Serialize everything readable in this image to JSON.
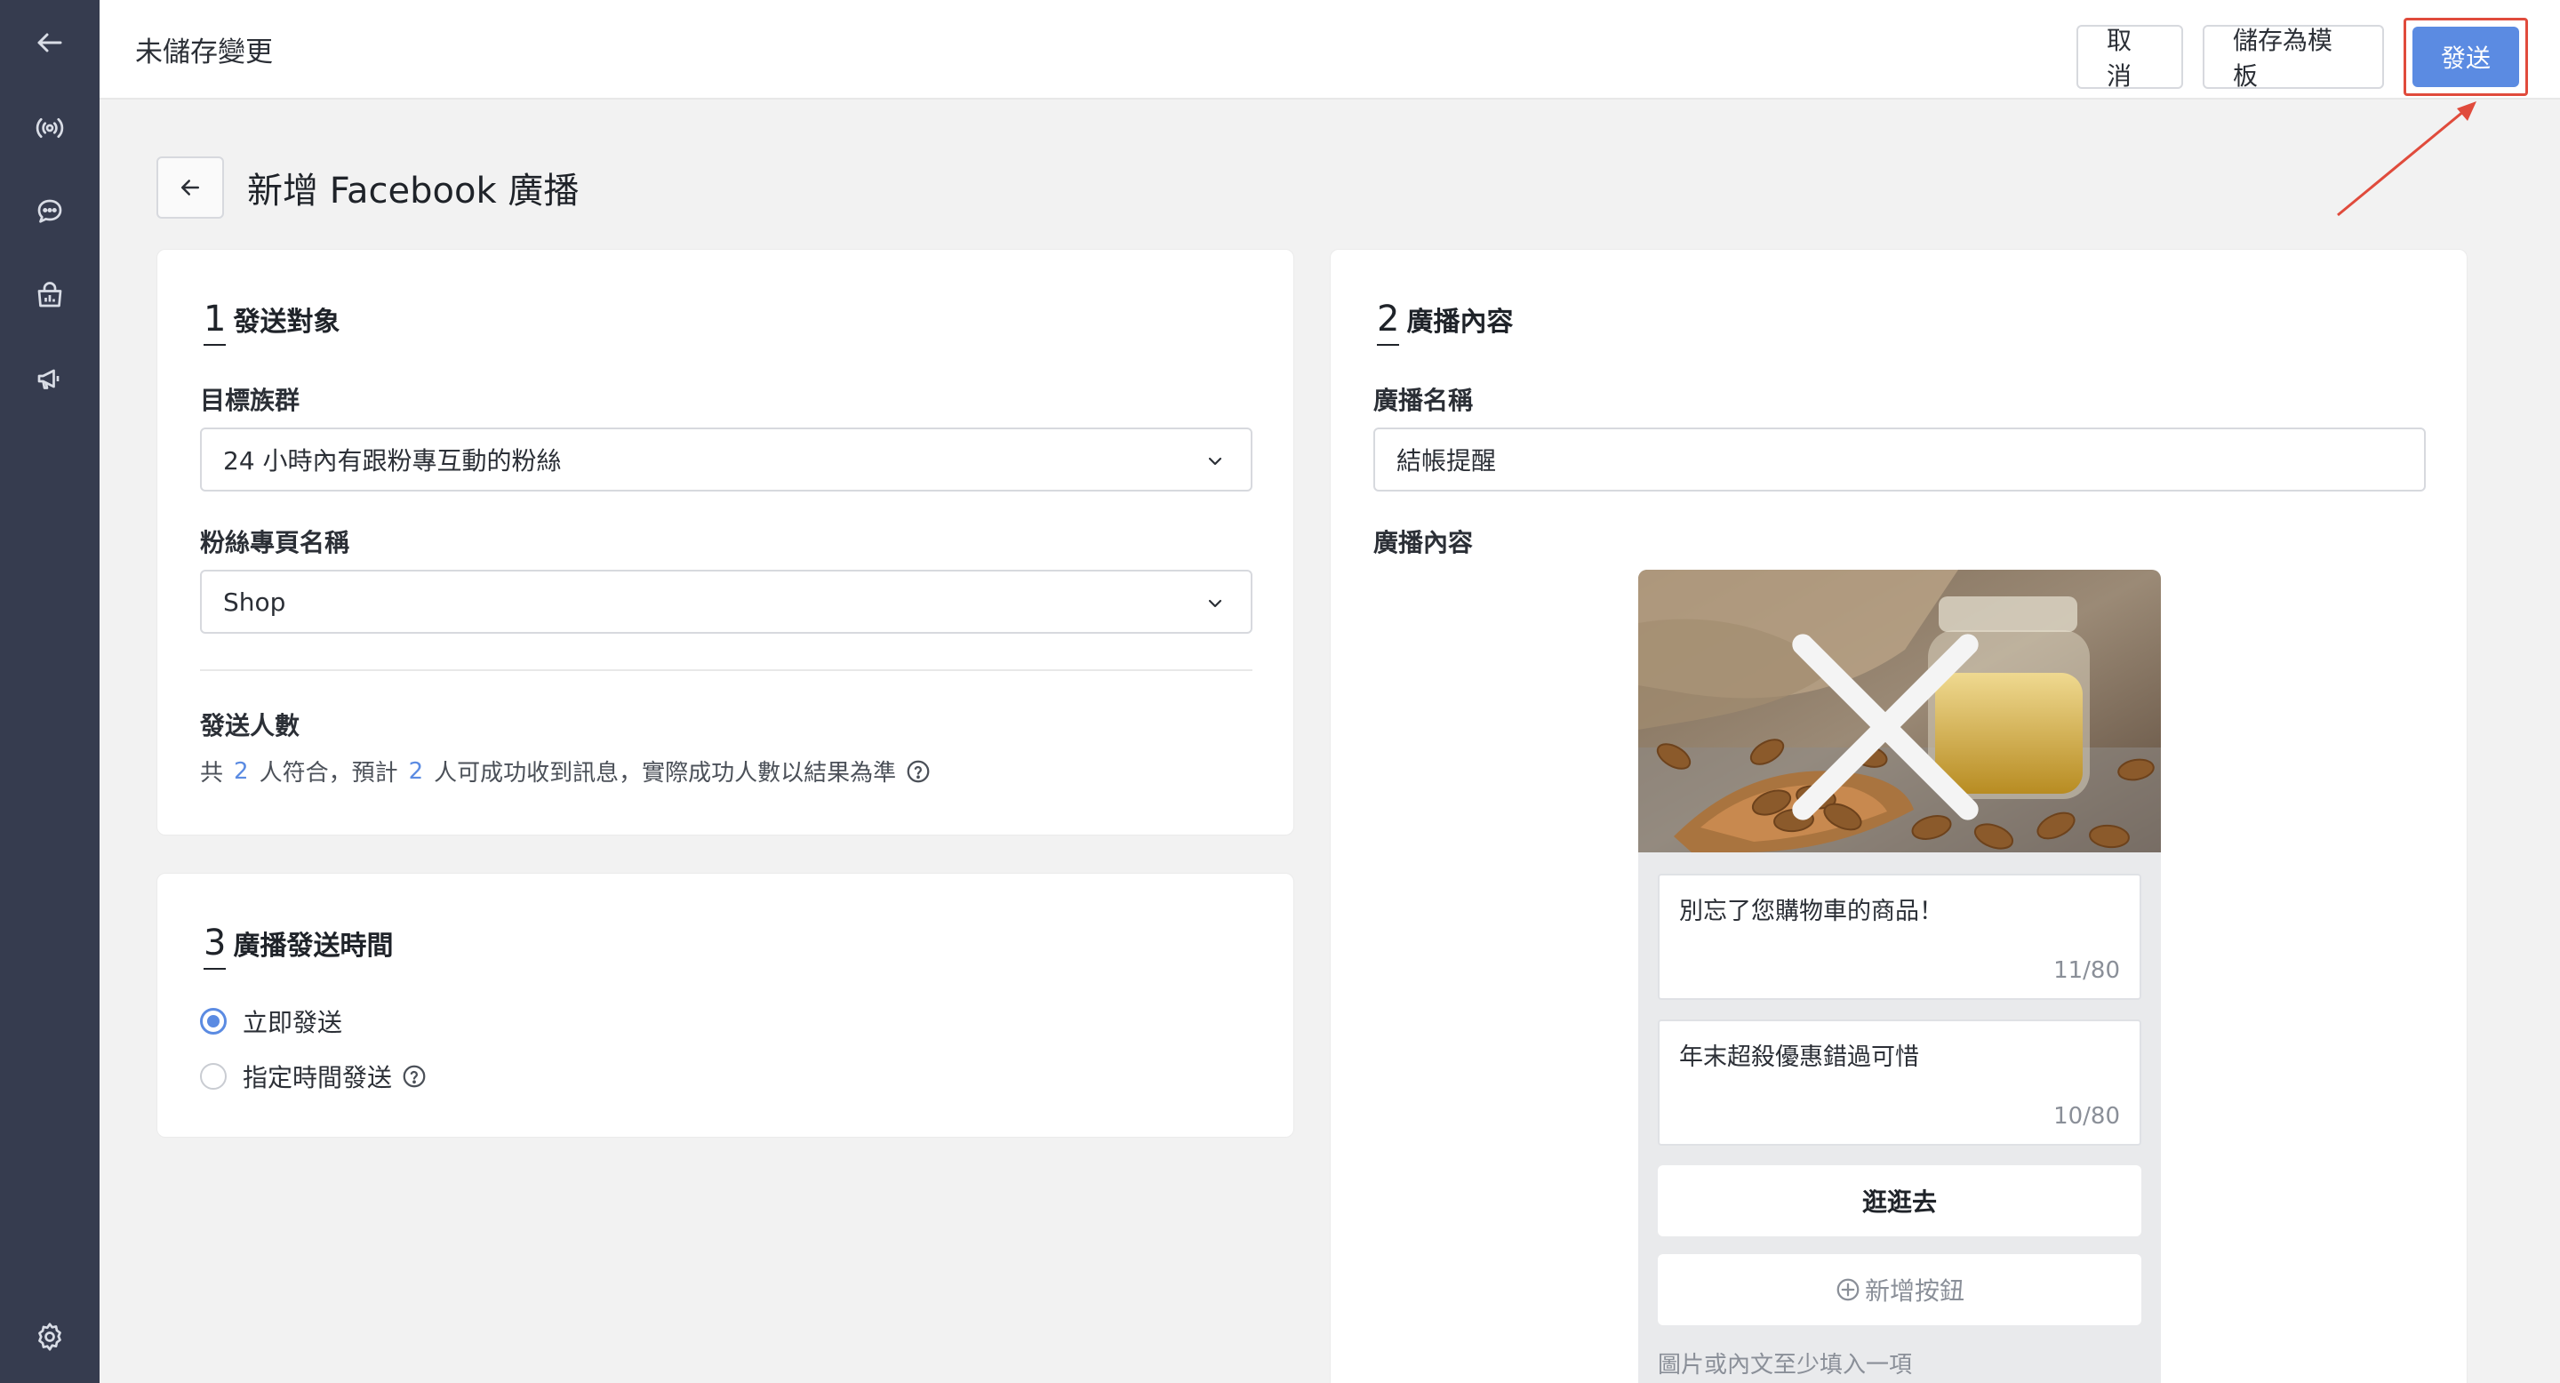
{
  "topbar": {
    "title": "未儲存變更",
    "cancel_label": "取消",
    "save_template_label": "儲存為模板",
    "send_label": "發送"
  },
  "page": {
    "title": "新增 Facebook 廣播"
  },
  "section1": {
    "step": "1",
    "title": "發送對象",
    "audience_label": "目標族群",
    "audience_value": "24 小時內有跟粉專互動的粉絲",
    "page_label": "粉絲專頁名稱",
    "page_value": "Shop",
    "count_label": "發送人數",
    "count_prefix": "共",
    "matched": "2",
    "count_mid": "人符合，預計",
    "expected": "2",
    "count_suffix": "人可成功收到訊息，實際成功人數以結果為準"
  },
  "section2": {
    "step": "2",
    "title": "廣播內容",
    "name_label": "廣播名稱",
    "name_value": "結帳提醒",
    "content_label": "廣播內容",
    "message_title": "別忘了您購物車的商品！",
    "message_title_count": "11/80",
    "message_subtitle": "年末超殺優惠錯過可惜",
    "message_subtitle_count": "10/80",
    "button_label": "逛逛去",
    "add_button_label": "新增按鈕",
    "hint": "圖片或內文至少填入一項"
  },
  "section3": {
    "step": "3",
    "title": "廣播發送時間",
    "option_now": "立即發送",
    "option_scheduled": "指定時間發送"
  },
  "colors": {
    "primary": "#5b8be2",
    "sidebar": "#363c4f",
    "annotation": "#e04b3c"
  }
}
